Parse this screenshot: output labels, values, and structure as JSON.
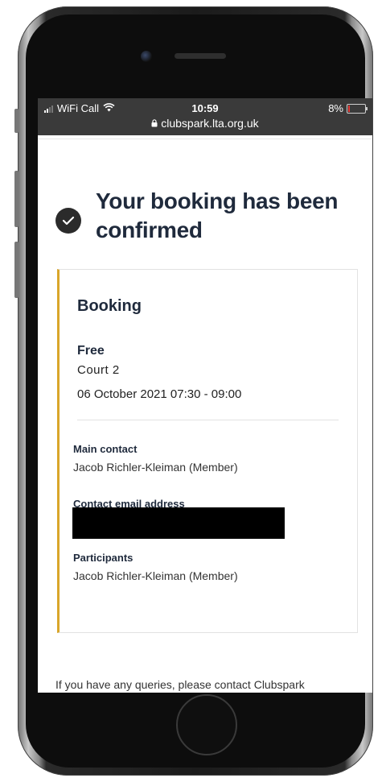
{
  "status_bar": {
    "carrier": "WiFi Call",
    "time": "10:59",
    "url": "clubspark.lta.org.uk",
    "battery": "8%",
    "battery_level_percent": 8,
    "battery_color": "#e53935"
  },
  "page": {
    "headline": "Your booking has been confirmed",
    "accent_color": "#d9a62a"
  },
  "booking": {
    "title": "Booking",
    "price": "Free",
    "court": "Court 2",
    "datetime": "06 October 2021 07:30 - 09:00",
    "main_contact_label": "Main contact",
    "main_contact_value": "Jacob Richler-Kleiman (Member)",
    "email_label": "Contact email address",
    "participants_label": "Participants",
    "participants_value": "Jacob Richler-Kleiman (Member)"
  },
  "footer": {
    "text": "If you have any queries, please contact Clubspark"
  },
  "icons": {
    "check": "check-circle-icon",
    "wifi": "wifi-icon",
    "lock": "lock-icon",
    "battery": "battery-icon",
    "signal": "signal-icon"
  }
}
